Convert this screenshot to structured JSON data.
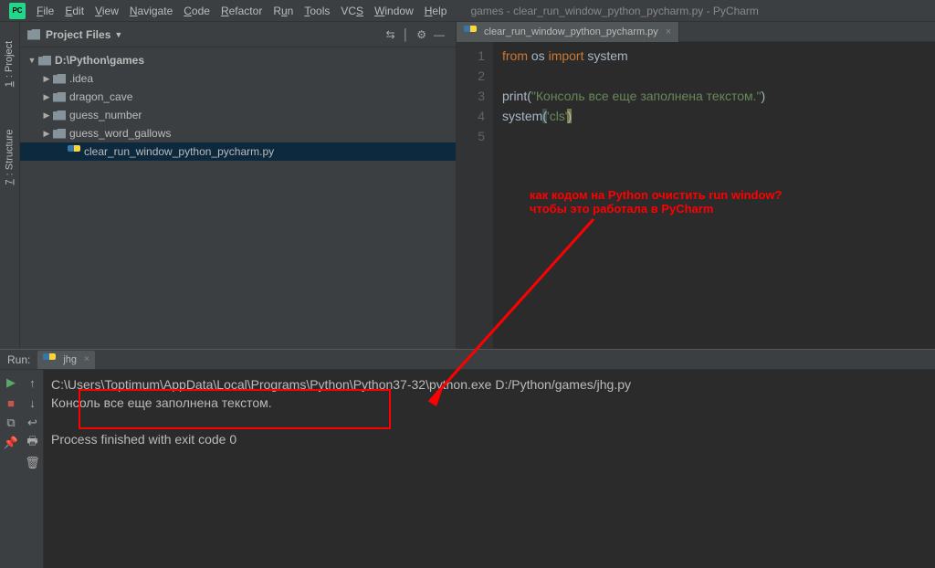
{
  "window_title": "games - clear_run_window_python_pycharm.py - PyCharm",
  "menu": [
    "File",
    "Edit",
    "View",
    "Navigate",
    "Code",
    "Refactor",
    "Run",
    "Tools",
    "VCS",
    "Window",
    "Help"
  ],
  "project_panel": {
    "title": "Project Files",
    "root": "D:\\Python\\games",
    "children": [
      ".idea",
      "dragon_cave",
      "guess_number",
      "guess_word_gallows"
    ],
    "selected_file": "clear_run_window_python_pycharm.py"
  },
  "editor": {
    "tab_name": "clear_run_window_python_pycharm.py",
    "lines": {
      "1": {
        "pre": "from",
        "mid": " os ",
        "pre2": "import",
        "rest": " system"
      },
      "3": {
        "fn": "print",
        "open": "(",
        "str": "\"Консоль все еще заполнена текстом.\"",
        "close": ")"
      },
      "4": {
        "fn": "system",
        "open": "(",
        "str": "'cls'",
        "close": ")"
      }
    }
  },
  "annotation": {
    "line1": "как кодом на Python очистить run window?",
    "line2": "чтобы это работала в PyCharm"
  },
  "run": {
    "label": "Run:",
    "tab": "jhg",
    "output": {
      "path": "C:\\Users\\Toptimum\\AppData\\Local\\Programs\\Python\\Python37-32\\python.exe D:/Python/games/jhg.py",
      "console_text": "Консоль все еще заполнена текстом.",
      "box_char": "\f",
      "finished": "Process finished with exit code 0"
    }
  },
  "gutter_tabs": {
    "project": "1: Project",
    "structure": "7: Structure"
  }
}
